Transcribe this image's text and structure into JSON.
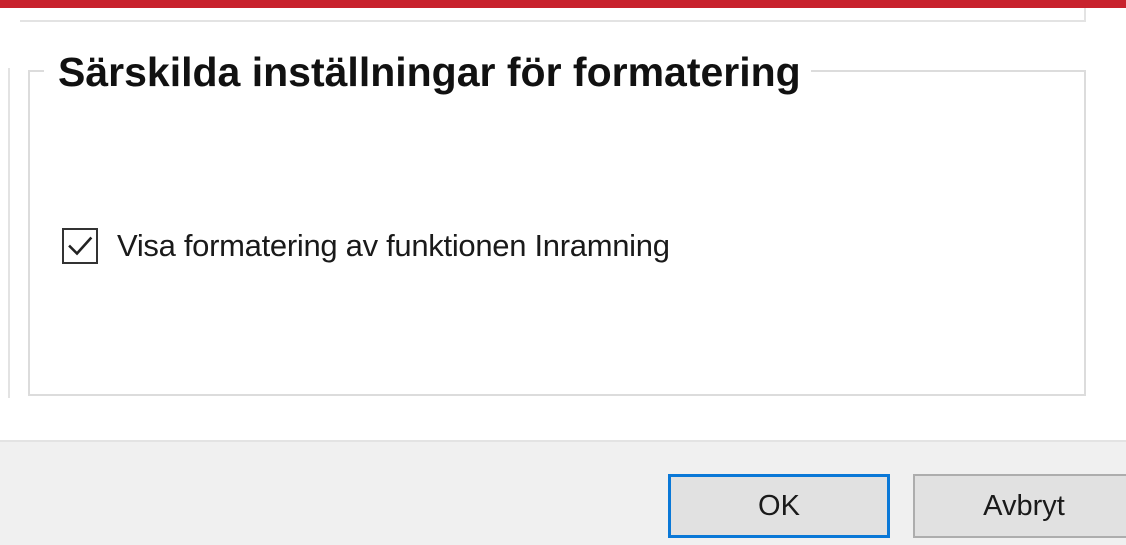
{
  "dialog": {
    "group_title": "Särskilda inställningar för formatering",
    "checkbox": {
      "label": "Visa formatering av funktionen Inramning",
      "checked": true
    },
    "buttons": {
      "ok_label": "OK",
      "cancel_label": "Avbryt"
    }
  },
  "colors": {
    "accent_bar": "#c8222d",
    "default_button_border": "#0a78d7"
  },
  "icons": {
    "checkmark": "check-icon"
  }
}
